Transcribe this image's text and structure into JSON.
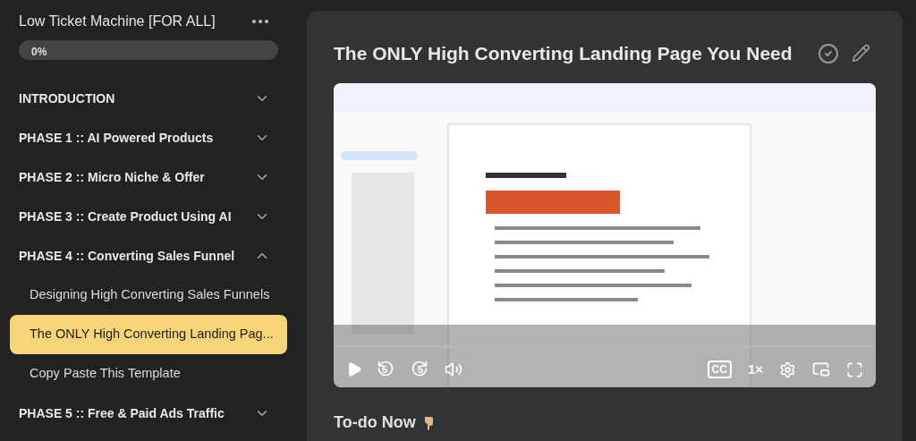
{
  "sidebar": {
    "course_title": "Low Ticket Machine [FOR ALL]",
    "progress": {
      "level": 0,
      "reading": "0%"
    },
    "sections": [
      {
        "title": "INTRODUCTION",
        "expanded": false
      },
      {
        "title": "PHASE 1 :: AI Powered Products",
        "expanded": false
      },
      {
        "title": "PHASE 2 :: Micro Niche & Offer",
        "expanded": false
      },
      {
        "title": "PHASE 3 :: Create Product Using AI",
        "expanded": false
      },
      {
        "title": "PHASE 4 :: Converting Sales Funnel",
        "expanded": true,
        "lessons": [
          {
            "title": "Designing High Converting Sales Funnels",
            "selected": false
          },
          {
            "title": "The ONLY High Converting Landing Pag...",
            "selected": true
          },
          {
            "title": "Copy Paste This Template",
            "selected": false
          }
        ]
      },
      {
        "title": "PHASE 5 :: Free & Paid Ads Traffic",
        "expanded": false
      }
    ]
  },
  "lesson": {
    "title": "The ONLY High Converting Landing Page You Need",
    "video": {
      "kind": "picture",
      "rewind_label": "5",
      "forward_label": "5",
      "captions_label": "CC",
      "speed": "1×"
    },
    "todo_heading": "To-do Now"
  }
}
